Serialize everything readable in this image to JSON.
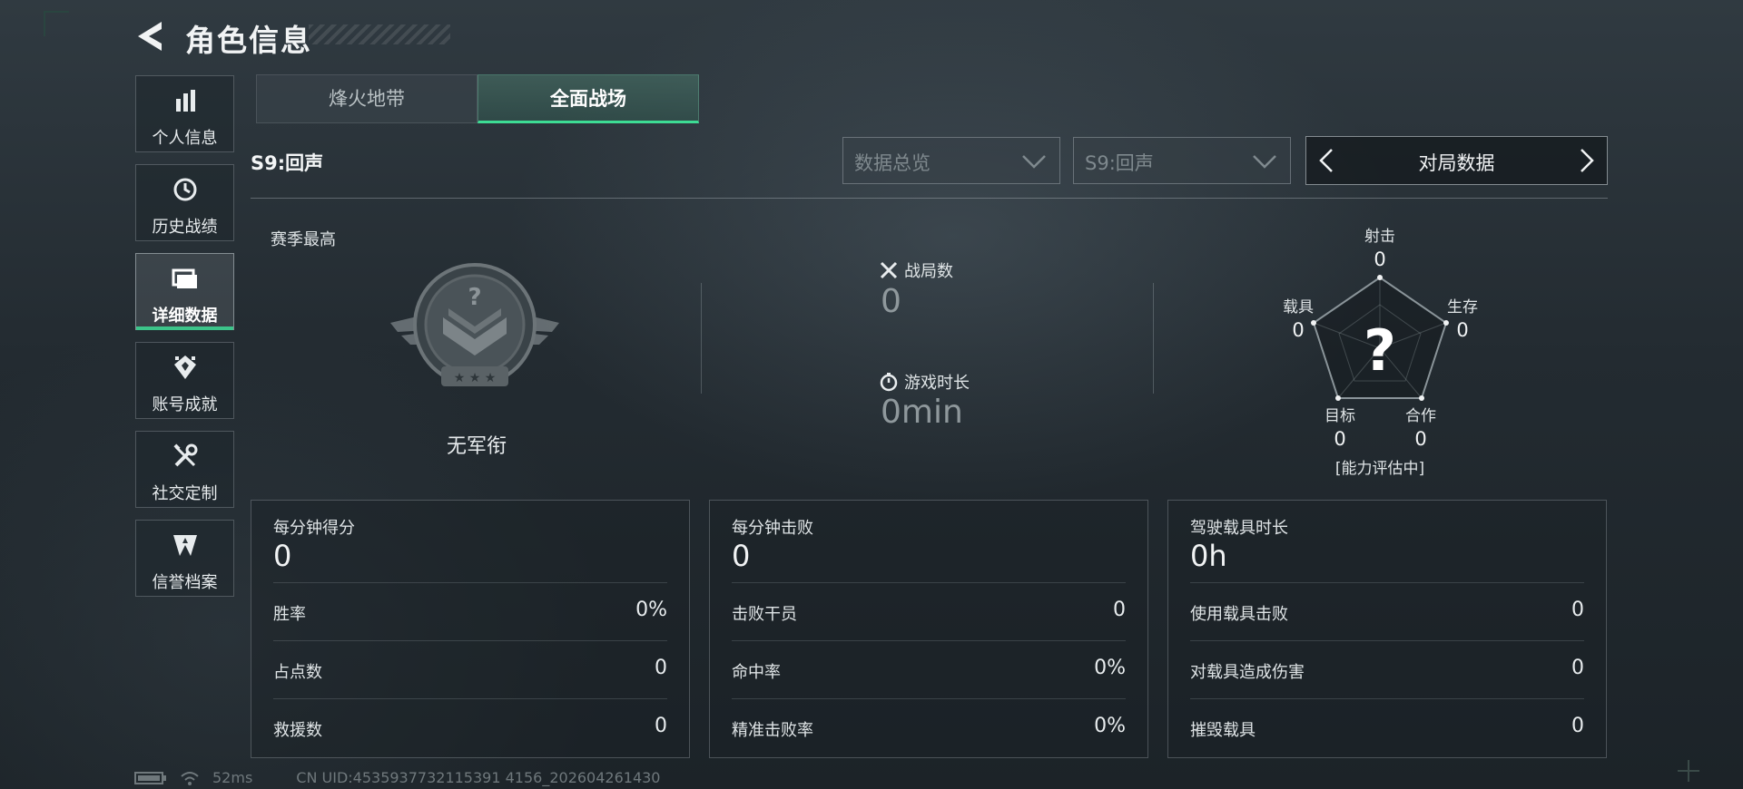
{
  "header": {
    "title": "角色信息"
  },
  "nav": [
    {
      "label": "个人信息",
      "icon": "bar-chart-icon",
      "active": false
    },
    {
      "label": "历史战绩",
      "icon": "history-clock-icon",
      "active": false
    },
    {
      "label": "详细数据",
      "icon": "folder-icon",
      "active": true
    },
    {
      "label": "账号成就",
      "icon": "achievement-badge-icon",
      "active": false
    },
    {
      "label": "社交定制",
      "icon": "tools-icon",
      "active": false
    },
    {
      "label": "信誉档案",
      "icon": "credit-emblem-icon",
      "active": false
    }
  ],
  "tabs": [
    {
      "label": "烽火地带",
      "active": false
    },
    {
      "label": "全面战场",
      "active": true
    }
  ],
  "season_label": "S9:回声",
  "filters": {
    "overview": "数据总览",
    "season": "S9:回声",
    "switch_label": "对局数据"
  },
  "summary": {
    "season_best_label": "赛季最高",
    "rank_name": "无军衔",
    "matches_label": "战局数",
    "matches_value": "0",
    "playtime_label": "游戏时长",
    "playtime_value": "0min"
  },
  "radar": {
    "center": "?",
    "status": "[能力评估中]",
    "axes": [
      {
        "label": "射击",
        "value": "0"
      },
      {
        "label": "生存",
        "value": "0"
      },
      {
        "label": "合作",
        "value": "0"
      },
      {
        "label": "目标",
        "value": "0"
      },
      {
        "label": "载具",
        "value": "0"
      }
    ]
  },
  "cards": [
    {
      "title": "每分钟得分",
      "value": "0",
      "rows": [
        {
          "label": "胜率",
          "value": "0%"
        },
        {
          "label": "占点数",
          "value": "0"
        },
        {
          "label": "救援数",
          "value": "0"
        }
      ]
    },
    {
      "title": "每分钟击败",
      "value": "0",
      "rows": [
        {
          "label": "击败干员",
          "value": "0"
        },
        {
          "label": "命中率",
          "value": "0%"
        },
        {
          "label": "精准击败率",
          "value": "0%"
        }
      ]
    },
    {
      "title": "驾驶载具时长",
      "value": "0h",
      "rows": [
        {
          "label": "使用载具击败",
          "value": "0"
        },
        {
          "label": "对载具造成伤害",
          "value": "0"
        },
        {
          "label": "摧毁载具",
          "value": "0"
        }
      ]
    }
  ],
  "status": {
    "ping": "52ms",
    "uid": "CN UID:4535937732115391 4156_202604261430"
  },
  "colors": {
    "accent": "#3ddc94",
    "panel_border": "#8a9499"
  }
}
